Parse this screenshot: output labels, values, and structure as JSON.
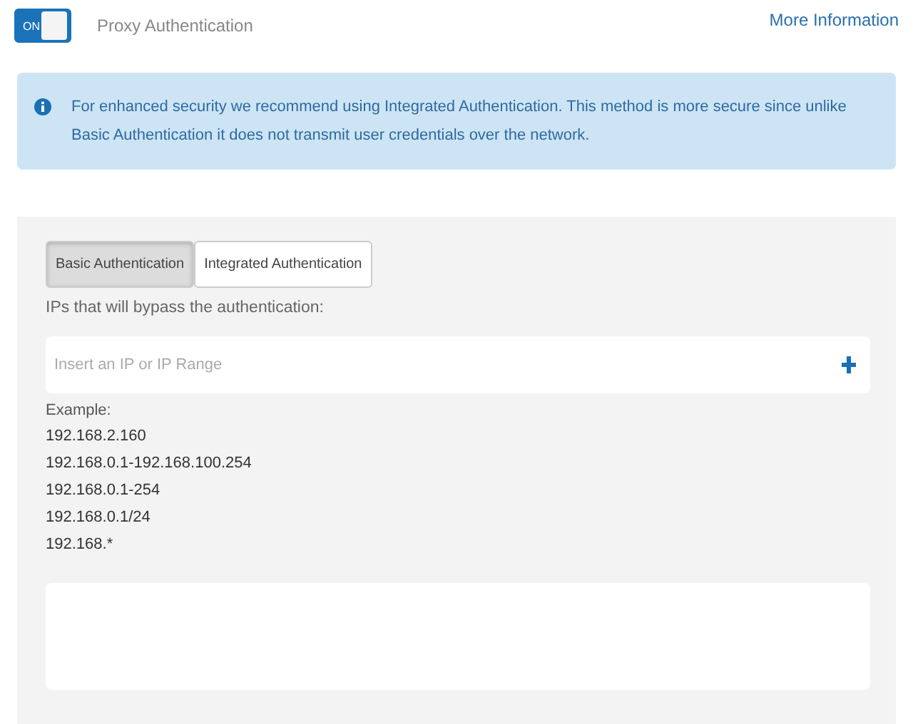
{
  "toggle": {
    "label": "ON",
    "on": true
  },
  "title": "Proxy Authentication",
  "more_link": "More Information",
  "info": "For enhanced security we recommend using Integrated Authentication. This method is more secure since unlike Basic Authentication it does not transmit user credentials over the network.",
  "tabs": [
    {
      "label": "Basic Authentication",
      "selected": true
    },
    {
      "label": "Integrated Authentication",
      "selected": false
    }
  ],
  "bypass_label": "IPs that will bypass the authentication:",
  "ip_field": {
    "placeholder": "Insert an IP or IP Range"
  },
  "example_label": "Example:",
  "examples": [
    "192.168.2.160",
    "192.168.0.1-192.168.100.254",
    "192.168.0.1-254",
    "192.168.0.1/24",
    "192.168.*"
  ]
}
